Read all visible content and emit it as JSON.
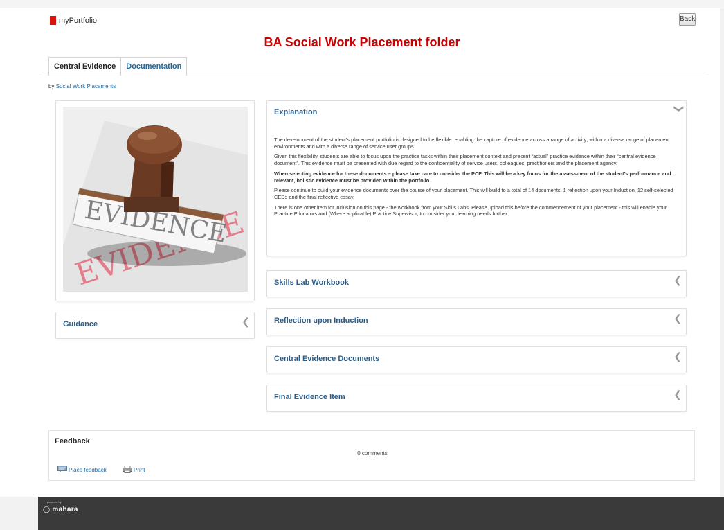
{
  "app": {
    "name": "myPortfolio",
    "back_label": "Back"
  },
  "page": {
    "title": "BA Social Work Placement folder"
  },
  "tabs": [
    {
      "label": "Central Evidence",
      "active": true
    },
    {
      "label": "Documentation",
      "active": false
    }
  ],
  "byline": {
    "prefix": "by",
    "author": "Social Work Placements"
  },
  "image": {
    "stamp_text": "EVIDENCE",
    "ink_text": "EVIDENCE"
  },
  "blocks": {
    "guidance": {
      "title": "Guidance"
    },
    "explanation": {
      "title": "Explanation",
      "paragraphs": [
        "The development of the student's placement portfolio is designed to be flexible: enabling the capture of evidence across a range of activity; within a diverse range of placement environments and with a diverse range of service user groups.",
        " Given this flexibility, students are able to focus upon the practice tasks within their placement context and present “actual” practice evidence within their “central evidence document”. This evidence must be presented with due regard to the confidentiality of service users, colleagues, practitioners and the placement agency.",
        "When selecting evidence for these documents – please take care to consider the PCF.  This will be a key focus for the assessment of the student’s performance and relevant, holistic evidence must be provided within the portfolio.",
        " Please continue to build your evidence documents over the course of your placement. This will build to a total of 14 documents, 1 reflection upon your Induction, 12 self-selected CEDs and the final reflective essay.",
        "There is one other item for inclusion on this page - the workbook from your Skills Labs. Please upload this before the commencement of your placement - this will enable your Practice Educators and (Where applicable) Practice Supervisor, to consider your learning needs further."
      ]
    },
    "skills_lab": {
      "title": "Skills Lab Workbook"
    },
    "reflection": {
      "title": "Reflection upon Induction"
    },
    "central_docs": {
      "title": "Central Evidence Documents"
    },
    "final_item": {
      "title": "Final Evidence Item"
    }
  },
  "feedback": {
    "title": "Feedback",
    "count": "0 comments",
    "place_label": "Place feedback",
    "print_label": "Print"
  },
  "footer": {
    "powered_by": "powered by",
    "brand": "mahara"
  },
  "colors": {
    "brand_red": "#d8140f",
    "title_red": "#cc0000",
    "link_blue": "#1f6aa1",
    "block_title": "#2b5c88",
    "footer_bg": "#3a3a3a"
  },
  "icons": {
    "collapse": "chevron-down-icon",
    "expand": "chevron-left-icon",
    "feedback": "speech-bubble-icon",
    "print": "printer-icon"
  }
}
